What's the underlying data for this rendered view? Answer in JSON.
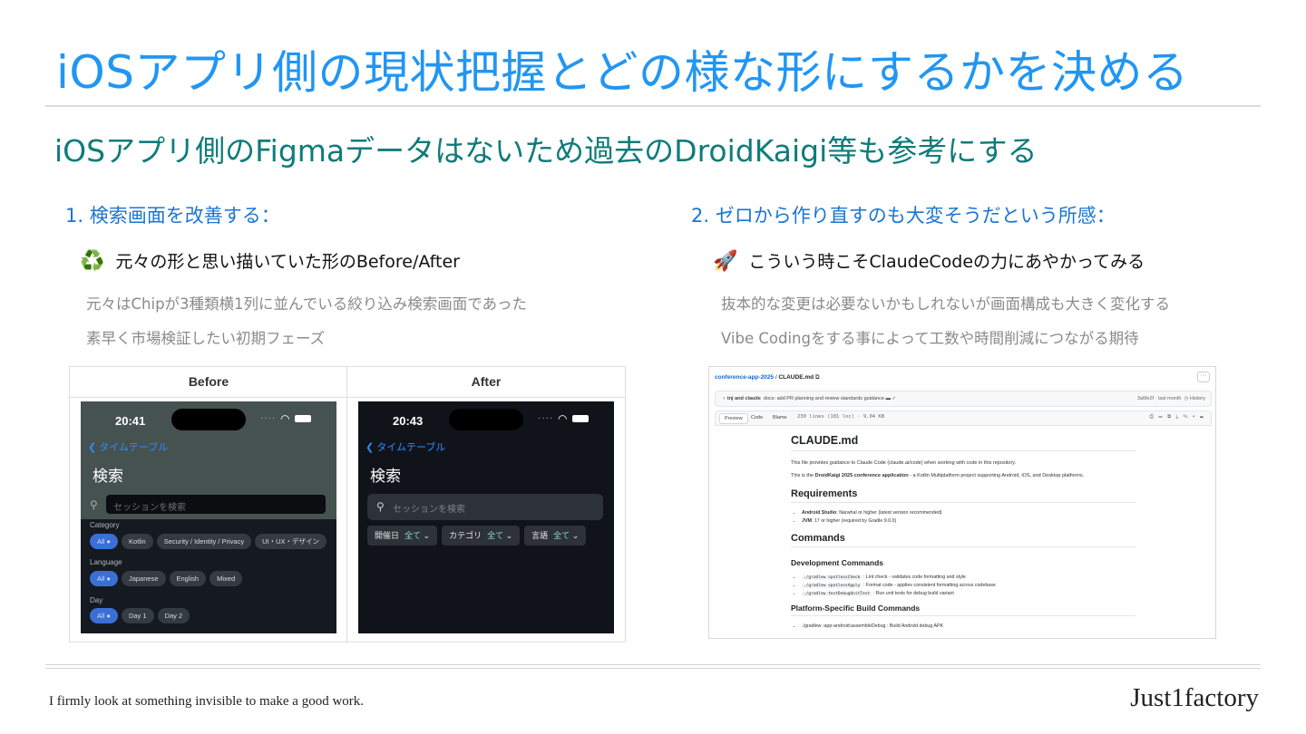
{
  "title": "iOSアプリ側の現状把握とどの様な形にするかを決める",
  "subtitle": "iOSアプリ側のFigmaデータはないため過去のDroidKaigi等も参考にする",
  "section1": {
    "heading": "1. 検索画面を改善する：",
    "point_icon": "recycle-icon",
    "point_glyph": "♻️",
    "point": "元々の形と思い描いていた形のBefore/After",
    "note1": "元々はChipが3種類横1列に並んでいる絞り込み検索画面であった",
    "note2": "素早く市場検証したい初期フェーズ",
    "table": {
      "before_label": "Before",
      "after_label": "After",
      "before_phone": {
        "time": "20:41",
        "back": "タイムテーブル",
        "title": "検索",
        "search_placeholder": "セッションを検索",
        "groups": [
          {
            "label": "Category",
            "chips": [
              "All",
              "Kotlin",
              "Security / Identity / Privacy",
              "UI・UX・デザイン"
            ]
          },
          {
            "label": "Language",
            "chips": [
              "All",
              "Japanese",
              "English",
              "Mixed"
            ]
          },
          {
            "label": "Day",
            "chips": [
              "All",
              "Day 1",
              "Day 2"
            ]
          }
        ]
      },
      "after_phone": {
        "time": "20:43",
        "back": "タイムテーブル",
        "title": "検索",
        "search_placeholder": "セッションを検索",
        "filters": [
          {
            "label": "開催日",
            "value": "全て"
          },
          {
            "label": "カテゴリ",
            "value": "全て"
          },
          {
            "label": "言語",
            "value": "全て"
          }
        ]
      }
    }
  },
  "section2": {
    "heading": "2. ゼロから作り直すのも大変そうだという所感：",
    "point_icon": "rocket-icon",
    "point_glyph": "🚀",
    "point": "こういう時こそClaudeCodeの力にあやかってみる",
    "note1": "抜本的な変更は必要ないかもしれないが画面構成も大きく変化する",
    "note2": "Vibe Codingをする事によって工数や時間削減につながる期待",
    "github": {
      "repo": "conference-app-2025",
      "file": "CLAUDE.md",
      "commit_authors": "tnj and claude",
      "commit_msg": "docs: add PR planning and review standards guidance",
      "commit_meta": "3a6fe2f · last month",
      "history": "History",
      "tabs": [
        "Preview",
        "Code",
        "Blame"
      ],
      "file_meta": "230 lines (181 loc) · 9.04 KB",
      "h1": "CLAUDE.md",
      "p1": "This file provides guidance to Claude Code (claude.ai/code) when working with code in this repository.",
      "p2_pre": "This is the ",
      "p2_bold": "DroidKaigi 2025 conference application",
      "p2_post": " - a Kotlin Multiplatform project supporting Android, iOS, and Desktop platforms.",
      "h2_req": "Requirements",
      "req1_b": "Android Studio",
      "req1": ": Narwhal or higher (latest version recommended)",
      "req2_b": "JVM",
      "req2": ": 17 or higher (required by Gradle 9.0.0)",
      "h2_cmd": "Commands",
      "h3_dev": "Development Commands",
      "cmd1_code": "./gradlew spotlessCheck",
      "cmd1": " : Lint check - validates code formatting and style",
      "cmd2_code": "./gradlew spotlessApply",
      "cmd2": " : Format code - applies consistent formatting across codebase",
      "cmd3_code": "./gradlew testDebugUnitTest",
      "cmd3": " : Run unit tests for debug build variant",
      "h3_platform": "Platform-Specific Build Commands",
      "cmd4": "./gradlew :app-android:assembleDebug : Build Android debug APK"
    }
  },
  "footer": {
    "tagline": "I firmly look at something invisible to make a good work.",
    "brand": "Just1factory"
  },
  "colors": {
    "title": "#2196f3",
    "subtitle": "#0f7c7a",
    "section_heading": "#1976d2",
    "note": "#8a8a8a"
  }
}
